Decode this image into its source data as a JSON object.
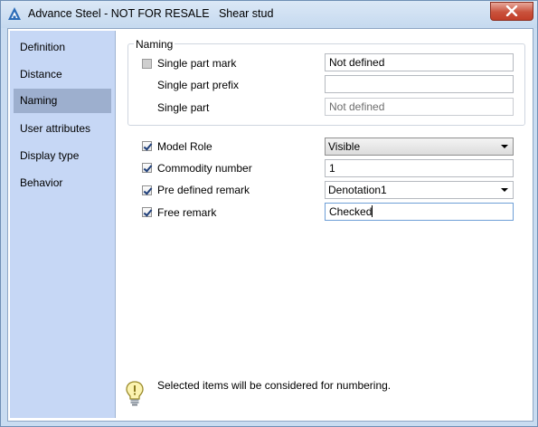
{
  "window": {
    "title": "Advance Steel - NOT FOR RESALE   Shear stud",
    "app_icon": "advance-steel-logo",
    "close_icon": "close-icon"
  },
  "sidebar": {
    "items": [
      {
        "label": "Definition",
        "active": false
      },
      {
        "label": "Distance",
        "active": false
      },
      {
        "label": "Naming",
        "active": true
      },
      {
        "label": "User attributes",
        "active": false
      },
      {
        "label": "Display type",
        "active": false
      },
      {
        "label": "Behavior",
        "active": false
      }
    ]
  },
  "naming_group": {
    "title": "Naming",
    "single_part_mark": {
      "label": "Single part mark",
      "checked": false,
      "value": "Not defined"
    },
    "single_part_prefix": {
      "label": "Single part prefix",
      "value": ""
    },
    "single_part": {
      "label": "Single part",
      "value": "Not defined"
    }
  },
  "options": {
    "model_role": {
      "label": "Model Role",
      "checked": true,
      "value": "Visible"
    },
    "commodity_number": {
      "label": "Commodity number",
      "checked": true,
      "value": "1"
    },
    "pre_defined_remark": {
      "label": "Pre defined remark",
      "checked": true,
      "value": "Denotation1"
    },
    "free_remark": {
      "label": "Free remark",
      "checked": true,
      "value": "Checked"
    }
  },
  "hint": {
    "icon": "lightbulb-icon",
    "text": "Selected items will be considered for numbering."
  },
  "colors": {
    "sidebar_bg": "#c6d7f5",
    "sidebar_active": "#9dafce",
    "frame": "#c9dcf1",
    "close_button": "#c9523c"
  }
}
